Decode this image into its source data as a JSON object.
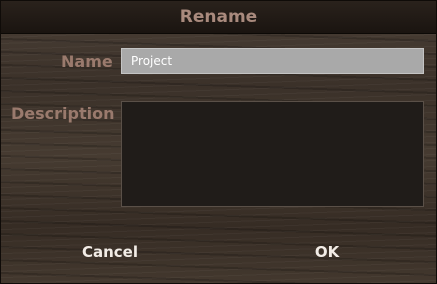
{
  "dialog": {
    "title": "Rename",
    "name_label": "Name",
    "name_value": "Project",
    "description_label": "Description",
    "description_value": "",
    "cancel_label": "Cancel",
    "ok_label": "OK"
  }
}
